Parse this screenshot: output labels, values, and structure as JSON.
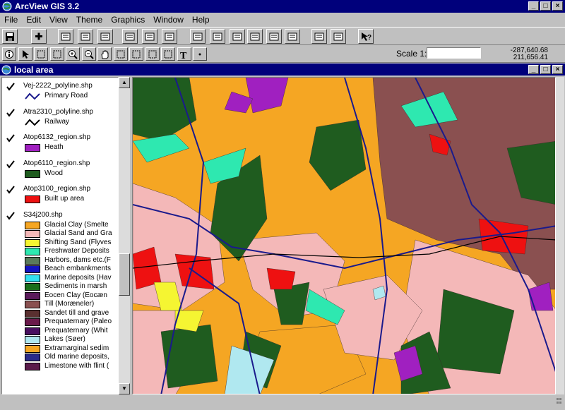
{
  "window": {
    "title": "ArcView GIS 3.2",
    "minimize": "_",
    "maximize": "□",
    "close": "×"
  },
  "menu": [
    "File",
    "Edit",
    "View",
    "Theme",
    "Graphics",
    "Window",
    "Help"
  ],
  "toolbar1_icons": [
    "save-icon",
    "add-theme-icon",
    "theme-properties-icon",
    "edit-legend-icon",
    "open-table-icon",
    "zoom-full-extent-icon",
    "zoom-to-themes-icon",
    "zoom-to-selected-icon",
    "zoom-in-icon",
    "zoom-out-icon",
    "zoom-previous-icon",
    "select-by-theme-icon",
    "find-icon",
    "locate-address-icon",
    "query-builder-icon",
    "clear-selection-icon",
    "help-icon"
  ],
  "toolbar2_icons": [
    "identify-icon",
    "pointer-icon",
    "vertex-edit-icon",
    "select-feature-icon",
    "zoom-in-tool-icon",
    "zoom-out-tool-icon",
    "pan-icon",
    "measure-icon",
    "hotlink-icon",
    "area-select-icon",
    "label-icon",
    "text-icon",
    "draw-point-icon"
  ],
  "scale": {
    "label": "Scale 1:",
    "value": ""
  },
  "coords": {
    "x": "-287,640.68",
    "y": "211,656.41"
  },
  "doc": {
    "title": "local area"
  },
  "legend": [
    {
      "name": "Vej-2222_polyline.shp",
      "checked": true,
      "type": "line",
      "color": "#1a1a8c",
      "items": [
        {
          "label": "Primary Road"
        }
      ]
    },
    {
      "name": "Atra2310_polyline.shp",
      "checked": true,
      "type": "line",
      "color": "#000000",
      "items": [
        {
          "label": "Railway"
        }
      ]
    },
    {
      "name": "Atop6132_region.shp",
      "checked": true,
      "type": "fill",
      "items": [
        {
          "label": "Heath",
          "color": "#a020c0"
        }
      ]
    },
    {
      "name": "Atop6110_region.shp",
      "checked": true,
      "type": "fill",
      "items": [
        {
          "label": "Wood",
          "color": "#1f5c1f"
        }
      ]
    },
    {
      "name": "Atop3100_region.shp",
      "checked": true,
      "type": "fill",
      "items": [
        {
          "label": "Built up area",
          "color": "#ee1111"
        }
      ]
    },
    {
      "name": "S34j200.shp",
      "checked": true,
      "type": "fill",
      "items": [
        {
          "label": "Glacial Clay (Smelte",
          "color": "#f5a623"
        },
        {
          "label": "Glacial Sand and Gra",
          "color": "#f4b8b8"
        },
        {
          "label": "Shifting Sand (Flyves",
          "color": "#f5f532"
        },
        {
          "label": "Freshwater Deposits",
          "color": "#2ee8b0"
        },
        {
          "label": "Harbors, dams etc.(F",
          "color": "#5a7a5a"
        },
        {
          "label": "Beach embankments",
          "color": "#1414c0"
        },
        {
          "label": "Marine deposits (Hav",
          "color": "#32e0f0"
        },
        {
          "label": "Sediments in marsh",
          "color": "#1a6e1a"
        },
        {
          "label": "Eocen Clay (Eocæn",
          "color": "#5a1a5a"
        },
        {
          "label": "Till (Moræneler)",
          "color": "#8a5050"
        },
        {
          "label": "Sandet till and grave",
          "color": "#5a3030"
        },
        {
          "label": "Prequaternary (Paleo",
          "color": "#6a1a4a"
        },
        {
          "label": "Prequaternary (Whit",
          "color": "#4a1060"
        },
        {
          "label": "Lakes (Søer)",
          "color": "#b0e8f0"
        },
        {
          "label": "Extramarginal sedim",
          "color": "#f5a623"
        },
        {
          "label": "Old marine deposits,",
          "color": "#2a2a8a"
        },
        {
          "label": "Limestone with flint (",
          "color": "#5a1a4a"
        }
      ]
    }
  ],
  "map_colors": {
    "clay": "#f5a623",
    "sand": "#f4b8b8",
    "till": "#8a5050",
    "wood": "#1f5c1f",
    "fresh": "#2ee8b0",
    "heath": "#a020c0",
    "built": "#ee1111",
    "shift": "#f5f532",
    "lake": "#b0e8f0",
    "road": "#1a1a8c"
  }
}
